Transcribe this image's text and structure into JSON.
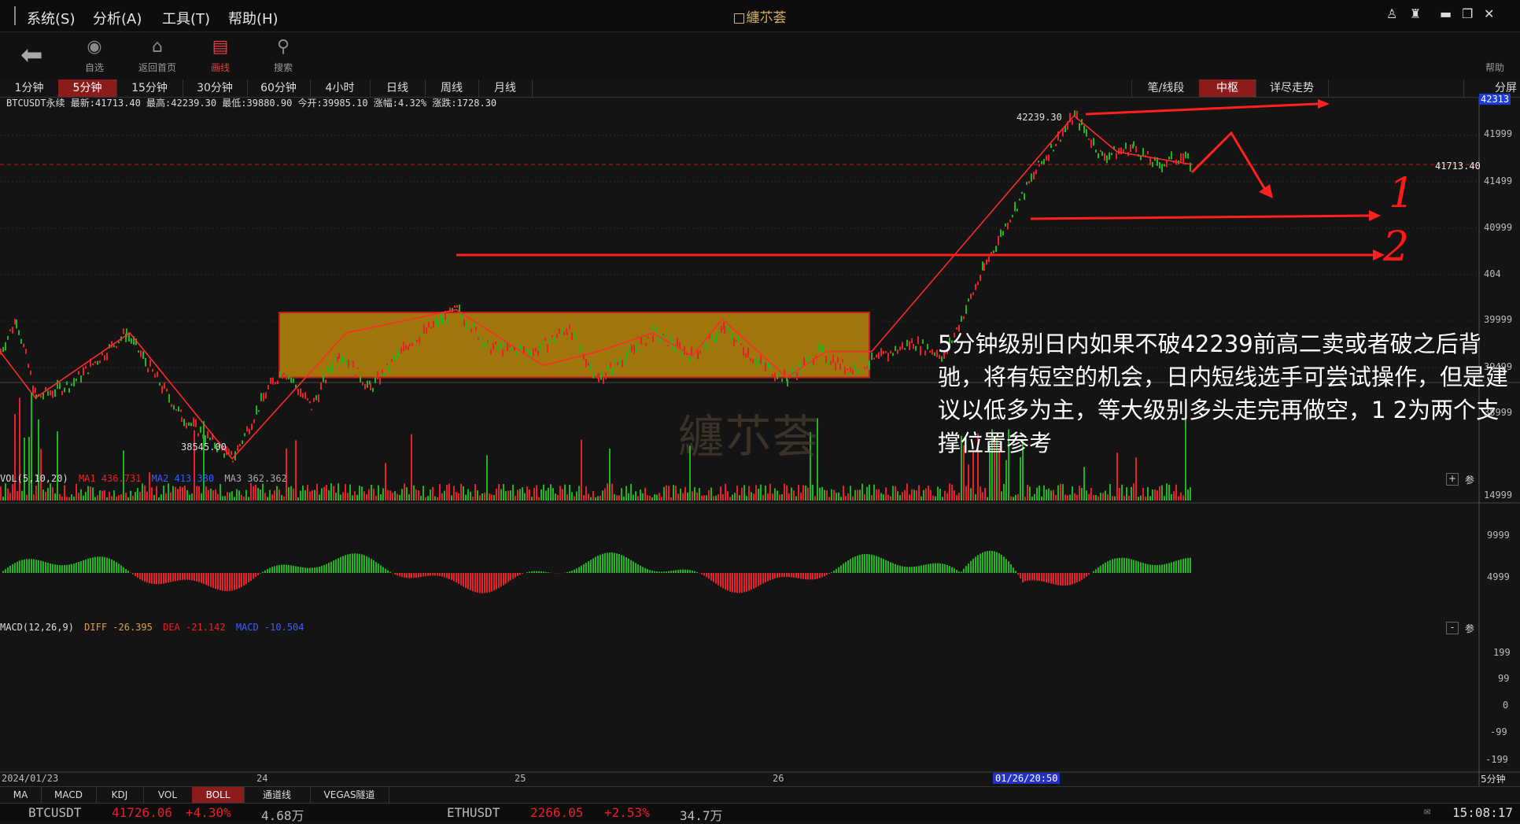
{
  "menu": [
    "系统(S)",
    "分析(A)",
    "工具(T)",
    "帮助(H)"
  ],
  "app_title": "纏䒕荟",
  "toolbar": [
    {
      "label": "自选",
      "icon": "coins-icon"
    },
    {
      "label": "返回首页",
      "icon": "home-icon"
    },
    {
      "label": "画线",
      "icon": "draw-line-icon",
      "active": true
    },
    {
      "label": "搜索",
      "icon": "search-icon"
    }
  ],
  "help_label": "帮助",
  "periods": [
    "1分钟",
    "5分钟",
    "15分钟",
    "30分钟",
    "60分钟",
    "4小时",
    "日线",
    "周线",
    "月线"
  ],
  "active_period": "5分钟",
  "right_tabs": [
    "笔/线段",
    "中枢",
    "详尽走势"
  ],
  "active_right_tab": "中枢",
  "split_label": "分屏",
  "info_line": "BTCUSDT永续  最新:41713.40 最高:42239.30 最低:39880.90 今开:39985.10 涨幅:4.32% 涨跌:1728.30",
  "main_chart": {
    "high_label": "42239.30",
    "low_label": "38545.00",
    "current_price": "41713.40",
    "y_ticks": [
      "42313",
      "41999",
      "41499",
      "40999",
      "404",
      "39999",
      "39499",
      "38999"
    ],
    "center_box": {
      "from_price": 39420,
      "to_price": 40120
    },
    "annotation": "5分钟级别日内如果不破42239前高二卖或者破之后背驰，将有短空的机会，日内短线选手可尝试操作，但是建议以低多为主，等大级别多头走完再做空，1 2为两个支撑位置参考",
    "support_marks": [
      "1",
      "2"
    ],
    "watermark": "纏䒕荟"
  },
  "vol_panel": {
    "label": "VOL(5,10,20)",
    "ma1": "MA1 436.731",
    "ma2": "MA2 413.380",
    "ma3": "MA3 362.362",
    "y_ticks": [
      "14999",
      "9999",
      "4999"
    ],
    "btn_plus": "+",
    "btn_can": "参"
  },
  "macd_panel": {
    "label": "MACD(12,26,9)",
    "diff": "DIFF -26.395",
    "dea": "DEA -21.142",
    "macd": "MACD -10.504",
    "y_ticks": [
      "199",
      "99",
      "0",
      "-99",
      "-199"
    ],
    "btn_minus": "-",
    "btn_can": "参"
  },
  "x_axis": {
    "labels": [
      "2024/01/23",
      "24",
      "25",
      "26"
    ],
    "cursor_label": "01/26/20:50",
    "right_label": "5分钟"
  },
  "indicator_tabs": [
    "MA",
    "MACD",
    "KDJ",
    "VOL",
    "BOLL",
    "通道线",
    "VEGAS隧道"
  ],
  "active_indicator": "BOLL",
  "ticker": [
    {
      "symbol": "BTCUSDT",
      "price": "41726.06",
      "change": "+4.30%",
      "volume": "4.68万"
    },
    {
      "symbol": "ETHUSDT",
      "price": "2266.05",
      "change": "+2.53%",
      "volume": "34.7万"
    }
  ],
  "clock": "15:08:17",
  "colors": {
    "up": "#1fb51f",
    "down": "#e8202a",
    "accent": "#8c1c1c",
    "center_fill": "#b8860b",
    "bi": "#ff2a2a",
    "annotation_arrow": "#ff2020"
  }
}
